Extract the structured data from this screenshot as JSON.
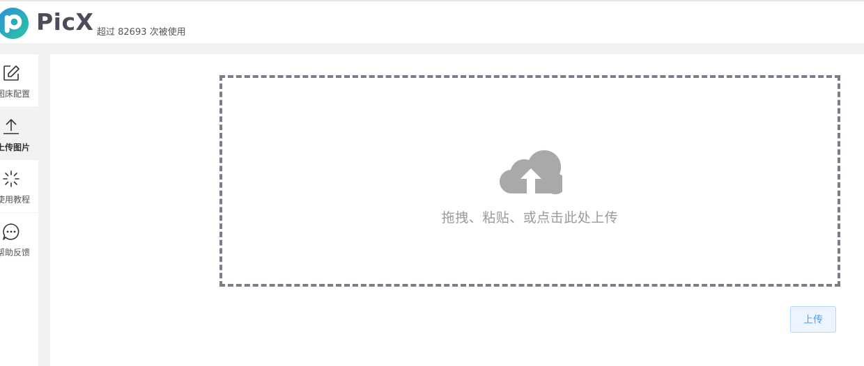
{
  "header": {
    "brand": "PicX",
    "usage_text": "超过 82693 次被使用"
  },
  "sidebar": {
    "items": [
      {
        "label": "图床配置",
        "icon": "edit-icon"
      },
      {
        "label": "上传图片",
        "icon": "upload-icon",
        "active": true
      },
      {
        "label": "使用教程",
        "icon": "loading-spinner-icon"
      },
      {
        "label": "帮助反馈",
        "icon": "chat-bubble-icon"
      }
    ]
  },
  "upload": {
    "dropzone_text": "拖拽、粘贴、或点击此处上传",
    "button_label": "上传",
    "icon": "cloud-upload-icon"
  },
  "colors": {
    "brand_text": "#4b4e5a",
    "dropzone_border": "#7d7c88",
    "cloud_icon": "#a9a9a9",
    "button_bg": "#ecf5ff",
    "button_text": "#409eff",
    "logo_teal": "#2ec4a5",
    "logo_blue": "#2b8fd6"
  }
}
